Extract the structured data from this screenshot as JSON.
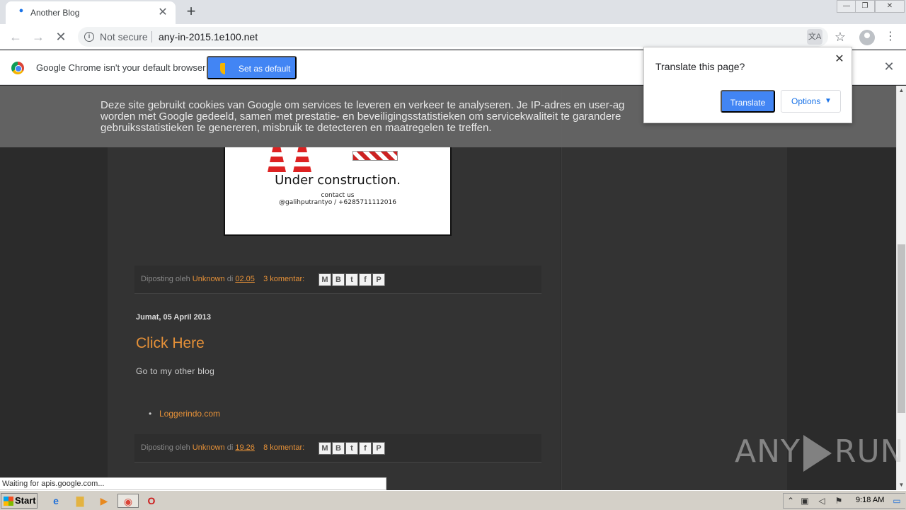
{
  "tab": {
    "title": "Another Blog",
    "close": "✕",
    "new_tab": "+"
  },
  "window_controls": {
    "minimize": "—",
    "maximize": "❐",
    "close": "✕"
  },
  "toolbar": {
    "back": "←",
    "forward": "→",
    "stop": "✕",
    "security_label": "Not secure",
    "url": "any-in-2015.1e100.net",
    "translate_icon": "文A",
    "bookmark_icon": "☆",
    "menu_icon": "⋮"
  },
  "infobar": {
    "text": "Google Chrome isn't your default browser",
    "button": "Set as default",
    "close": "✕"
  },
  "cookie_notice": {
    "lines": [
      "Deze site gebruikt cookies van Google om services te leveren en verkeer te analyseren. Je IP-adres en user-ag",
      "worden met Google gedeeld, samen met prestatie- en beveiligingsstatistieken om servicekwaliteit te garandere",
      "gebruiksstatistieken te genereren, misbruik te detecteren en maatregelen te treffen."
    ]
  },
  "construction_image": {
    "title": "Under construction.",
    "contact_line1": "contact us",
    "contact_line2": "@galihputrantyo / +6285711112016"
  },
  "posts": [
    {
      "footer": {
        "posted_by": "Diposting oleh",
        "author": "Unknown",
        "at": "di",
        "time": "02.05",
        "comments": "3 komentar:"
      }
    },
    {
      "date": "Jumat, 05 April 2013",
      "title": "Click Here",
      "body": "Go to my other blog",
      "list": [
        {
          "bullet": "•",
          "link": "Loggerindo.com"
        }
      ],
      "footer": {
        "posted_by": "Diposting oleh",
        "author": "Unknown",
        "at": "di",
        "time": "19.26",
        "comments": "8 komentar:"
      }
    }
  ],
  "share_buttons": {
    "email": "M",
    "blog": "B",
    "twitter": "t",
    "facebook": "f",
    "pinterest": "P"
  },
  "translate_bubble": {
    "title": "Translate this page?",
    "close": "✕",
    "translate_button": "Translate",
    "options_button": "Options",
    "caret": "▼"
  },
  "scrollbar": {
    "up": "▲",
    "down": "▼"
  },
  "status_bubble": "Waiting for apis.google.com...",
  "watermark": {
    "left": "ANY",
    "right": "RUN"
  },
  "taskbar": {
    "start": "Start",
    "apps": {
      "ie": "e",
      "explorer": "▇",
      "media": "▶",
      "chrome": "◉",
      "opera": "O"
    },
    "tray": {
      "chevron": "⌃",
      "network": "▣",
      "volume": "◁",
      "flag": "⚑",
      "desktop": "▭"
    },
    "clock": "9:18 AM"
  },
  "colors": {
    "accent_blue": "#4285f4",
    "link_orange": "#e69138",
    "page_bg": "#2b2b2b"
  }
}
